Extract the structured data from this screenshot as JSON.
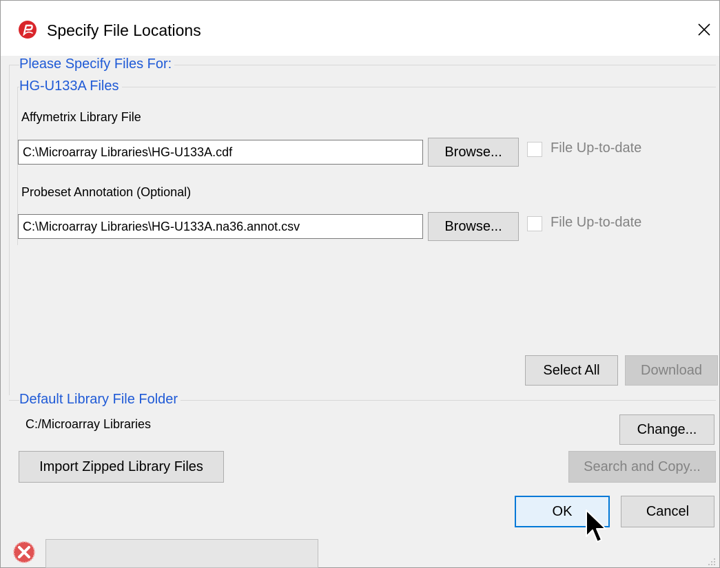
{
  "window": {
    "title": "Specify File Locations"
  },
  "section": {
    "header": "Please Specify Files For:",
    "subheader": "HG-U133A Files"
  },
  "library_file": {
    "label": "Affymetrix Library File",
    "value": "C:\\Microarray Libraries\\HG-U133A.cdf",
    "browse_label": "Browse...",
    "uptodate_label": "File Up-to-date",
    "uptodate_checked": false
  },
  "annotation_file": {
    "label": "Probeset Annotation (Optional)",
    "value": "C:\\Microarray Libraries\\HG-U133A.na36.annot.csv",
    "browse_label": "Browse...",
    "uptodate_label": "File Up-to-date",
    "uptodate_checked": false
  },
  "actions": {
    "select_all_label": "Select All",
    "download_label": "Download"
  },
  "default_folder": {
    "header": "Default Library File Folder",
    "path": "C:/Microarray Libraries",
    "change_label": "Change..."
  },
  "bottom": {
    "import_label": "Import Zipped Library Files",
    "search_copy_label": "Search and Copy...",
    "ok_label": "OK",
    "cancel_label": "Cancel"
  },
  "status": {
    "text": ""
  },
  "icons": {
    "app": "partek-app-icon",
    "close": "close-icon",
    "status": "error-status-icon",
    "cursor": "mouse-pointer-icon"
  },
  "colors": {
    "header_blue": "#1f5ad6",
    "app_icon_red": "#d9262b",
    "status_icon_red": "#e05252",
    "default_button_border": "#0078d7"
  }
}
